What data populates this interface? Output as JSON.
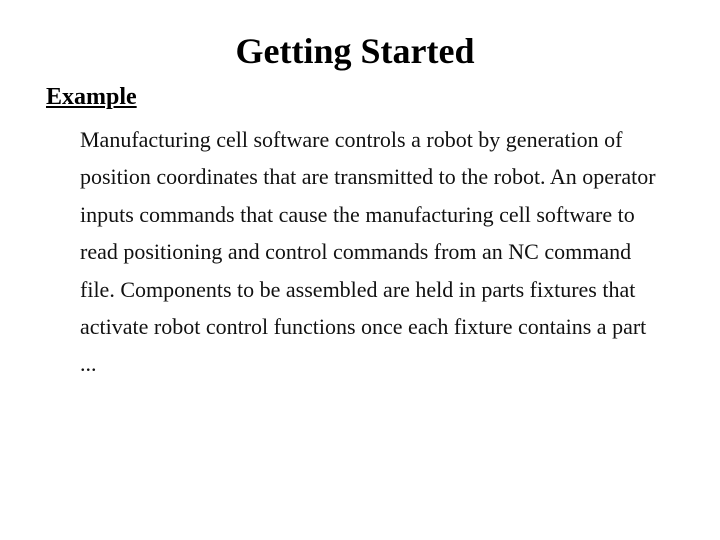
{
  "title": "Getting Started",
  "section_heading": "Example",
  "body": "Manufacturing cell software controls a robot by generation of position coordinates that are transmitted to the robot. An operator inputs commands that cause the manufacturing cell software to read positioning and control commands from an NC command file. Components to be assembled are held in parts fixtures that activate robot control functions once each fixture contains a part ..."
}
